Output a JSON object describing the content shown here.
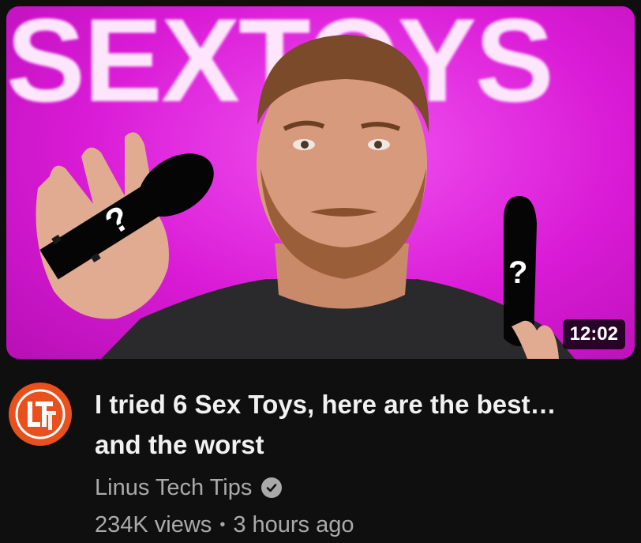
{
  "video": {
    "thumbnail_text": "SEXTOYS",
    "duration": "12:02",
    "title": "I tried 6 Sex Toys, here are the best… and the worst",
    "channel": "Linus Tech Tips",
    "views": "234K views",
    "age": "3 hours ago",
    "separator": "•",
    "verified_icon": "check-circle-icon",
    "avatar_text": "LTT"
  },
  "colors": {
    "thumbnail_bg": "#d91bd6",
    "avatar_bg": "#e8501e",
    "meta_text": "#aaaaaa",
    "title_text": "#f1f1f1",
    "page_bg": "#0f0f0f"
  }
}
